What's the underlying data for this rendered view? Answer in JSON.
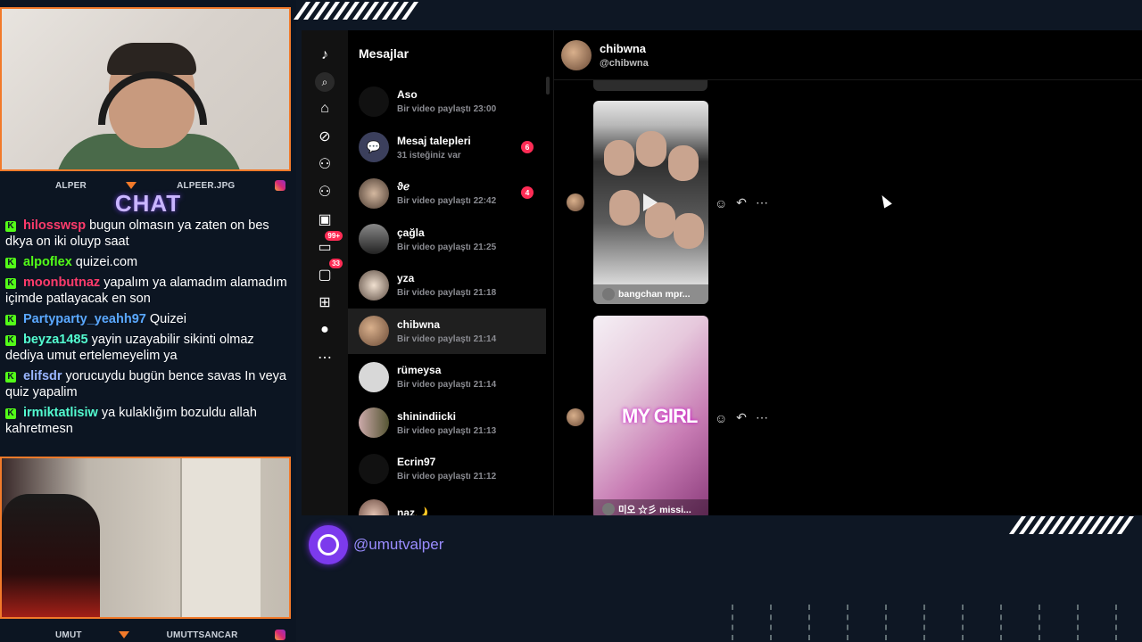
{
  "overlay": {
    "cam_top_label_left": "ALPER",
    "cam_top_label_right": "ALPEER.JPG",
    "cam_bottom_label_left": "UMUT",
    "cam_bottom_label_right": "UMUTTSANCAR",
    "chat_title": "CHAT",
    "handle": "@umutvalper"
  },
  "chat": [
    {
      "user": "hilosswsp",
      "color": "#ff3b6b",
      "text": "bugun olmasın ya zaten on bes dkya on iki oluyp saat"
    },
    {
      "user": "alpoflex",
      "color": "#53fc18",
      "text": "quizei.com"
    },
    {
      "user": "moonbutnaz",
      "color": "#ff3b6b",
      "text": "yapalım ya alamadım alamadım içimde patlayacak en son"
    },
    {
      "user": "Partyparty_yeahh97",
      "color": "#5aa8ff",
      "text": "Quizei"
    },
    {
      "user": "beyza1485",
      "color": "#53fcd0",
      "text": "yayin uzayabilir sikinti olmaz dediya umut ertelemeyelim ya"
    },
    {
      "user": "elifsdr",
      "color": "#9ab6ff",
      "text": "yorucuydu bugün bence savas In veya quiz yapalim"
    },
    {
      "user": "irmiktatlisiw",
      "color": "#53fcd0",
      "text": "ya kulaklığım bozuldu allah kahretmesn"
    }
  ],
  "rail": {
    "badge_99": "99+",
    "badge_33": "33"
  },
  "messages_panel": {
    "title": "Mesajlar",
    "conversations": [
      {
        "name": "Aso",
        "sub": "Bir video paylaştı 23:00",
        "badge": ""
      },
      {
        "name": "Mesaj talepleri",
        "sub": "31 isteğiniz var",
        "badge": "6"
      },
      {
        "name": "ϑℯ",
        "sub": "Bir video paylaştı 22:42",
        "badge": "4"
      },
      {
        "name": "çağla",
        "sub": "Bir video paylaştı 21:25",
        "badge": ""
      },
      {
        "name": "yza",
        "sub": "Bir video paylaştı 21:18",
        "badge": ""
      },
      {
        "name": "chibwna",
        "sub": "Bir video paylaştı 21:14",
        "badge": ""
      },
      {
        "name": "rümeysa",
        "sub": "Bir video paylaştı 21:14",
        "badge": ""
      },
      {
        "name": "shinindiicki",
        "sub": "Bir video paylaştı 21:13",
        "badge": ""
      },
      {
        "name": "Ecrin97",
        "sub": "Bir video paylaştı 21:12",
        "badge": ""
      },
      {
        "name": "naz🌙",
        "sub": "",
        "badge": ""
      }
    ]
  },
  "thread": {
    "name": "chibwna",
    "handle": "@chibwna",
    "videos": [
      {
        "caption": "bangchan mpr..."
      },
      {
        "caption": "미오 ☆彡 missi...",
        "overlay_text": "MY GIRL"
      }
    ]
  }
}
